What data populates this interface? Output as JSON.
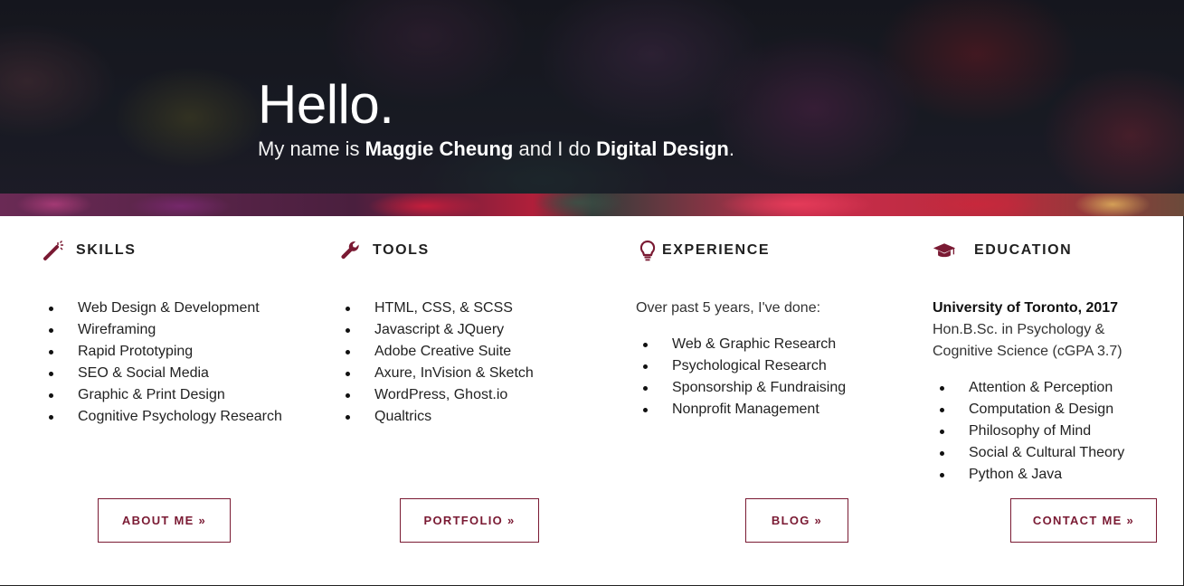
{
  "hero": {
    "title": "Hello.",
    "sub_pre": "My name is ",
    "name": "Maggie Cheung",
    "sub_mid": " and I do ",
    "role": "Digital Design",
    "sub_post": "."
  },
  "colors": {
    "accent": "#7a1a33",
    "text": "#222222"
  },
  "sections": {
    "skills": {
      "icon": "magic-wand-icon",
      "title": "SKILLS",
      "items": [
        "Web Design & Development",
        "Wireframing",
        "Rapid Prototyping",
        "SEO & Social Media",
        "Graphic & Print Design",
        "Cognitive Psychology Research"
      ],
      "button": "ABOUT ME »"
    },
    "tools": {
      "icon": "wrench-icon",
      "title": "TOOLS",
      "items": [
        "HTML, CSS, & SCSS",
        "Javascript & JQuery",
        "Adobe Creative Suite",
        "Axure, InVision & Sketch",
        "WordPress, Ghost.io",
        "Qualtrics"
      ],
      "button": "PORTFOLIO »"
    },
    "experience": {
      "icon": "lightbulb-icon",
      "title": "EXPERIENCE",
      "intro": "Over past 5 years, I've done:",
      "items": [
        "Web & Graphic Research",
        "Psychological Research",
        "Sponsorship & Fundraising",
        "Nonprofit Management"
      ],
      "button": "BLOG »"
    },
    "education": {
      "icon": "graduation-cap-icon",
      "title": "EDUCATION",
      "university": "University of Toronto, 2017",
      "degree_line1": "Hon.B.Sc. in Psychology &",
      "degree_line2": "Cognitive Science (cGPA 3.7)",
      "items": [
        "Attention & Perception",
        "Computation & Design",
        "Philosophy of Mind",
        "Social & Cultural Theory",
        "Python & Java"
      ],
      "button": "CONTACT ME »"
    }
  }
}
